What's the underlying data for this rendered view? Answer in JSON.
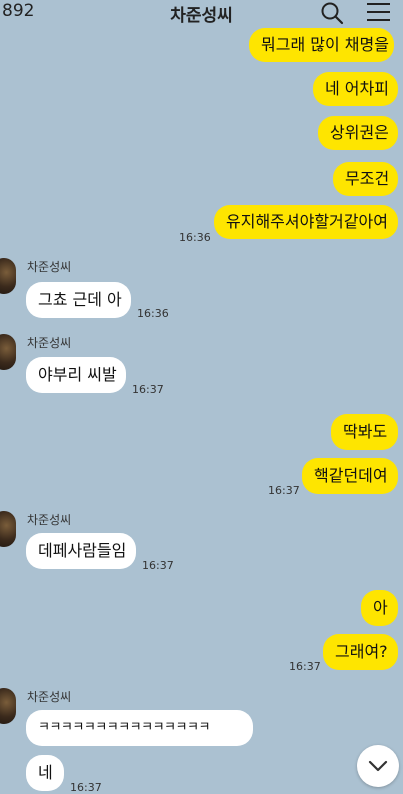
{
  "header": {
    "unread_count": "892",
    "title": "차준성씨",
    "search_icon": "search-icon",
    "menu_icon": "hamburger-menu-icon"
  },
  "messages": [
    {
      "text": "뭐그래 많이 채명을"
    },
    {
      "text": "네 어차피"
    },
    {
      "text": "상위권은"
    },
    {
      "text": "무조건"
    },
    {
      "text": "유지해주셔야할거같아여",
      "time": "16:36"
    },
    {
      "sender": "차준성씨",
      "text": "그쵸 근데 아",
      "time": "16:36"
    },
    {
      "sender": "차준성씨",
      "text": "야부리 씨발",
      "time": "16:37"
    },
    {
      "text": "딱봐도"
    },
    {
      "text": "핵같던데여",
      "time": "16:37"
    },
    {
      "sender": "차준성씨",
      "text": "데페사람들임",
      "time": "16:37"
    },
    {
      "text": "아"
    },
    {
      "text": "그래여?",
      "time": "16:37"
    },
    {
      "sender": "차준성씨",
      "text": "ㅋㅋㅋㅋㅋㅋㅋㅋㅋㅋㅋㅋㅋㅋㅋ"
    },
    {
      "text": "네",
      "time": "16:37"
    }
  ],
  "scroll_button": {
    "icon": "chevron-down-icon"
  },
  "colors": {
    "background": "#abc1d1",
    "my_bubble": "#fee500",
    "their_bubble": "#ffffff"
  }
}
